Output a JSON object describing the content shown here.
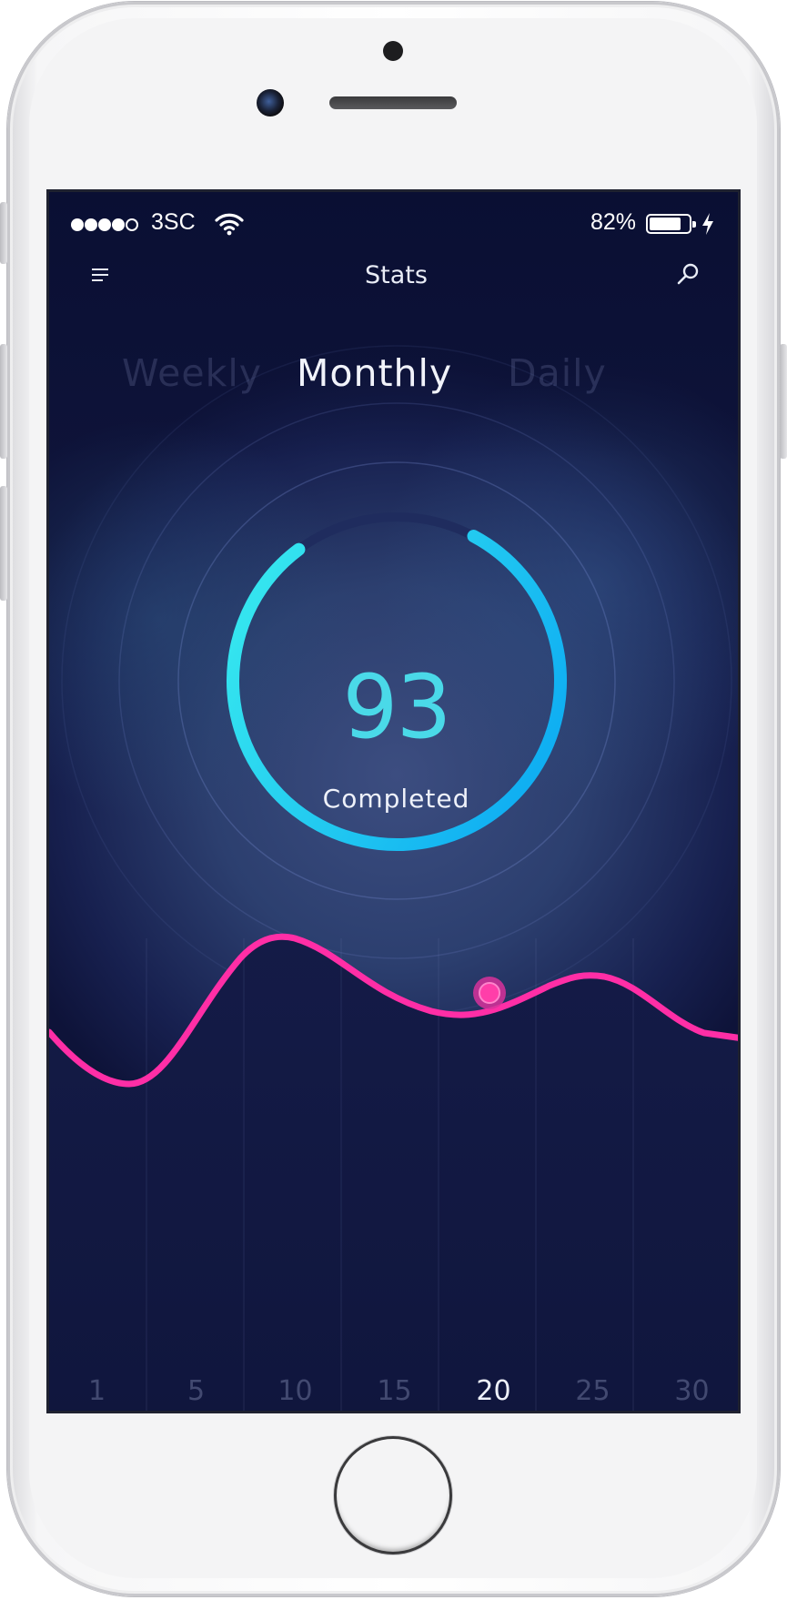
{
  "status_bar": {
    "signal_bars_filled": 4,
    "signal_bars_total": 5,
    "carrier": "3SC",
    "battery_percent": "82%",
    "battery_level": 0.82,
    "icons": [
      "signal-dots-icon",
      "wifi-icon",
      "battery-icon",
      "charging-bolt-icon"
    ]
  },
  "header": {
    "title": "Stats",
    "left_icon": "menu-icon",
    "right_icon": "search-icon"
  },
  "tabs": [
    {
      "label": "Weekly",
      "active": false
    },
    {
      "label": "Monthly",
      "active": true
    },
    {
      "label": "Daily",
      "active": false
    }
  ],
  "progress_ring": {
    "value": "93",
    "label": "Completed",
    "filled_fraction": 0.82,
    "colors": {
      "start": "#32e2ee",
      "end": "#12b0f2",
      "track": "#1f2c5e"
    }
  },
  "chart_data": {
    "type": "line",
    "x_ticks": [
      "1",
      "5",
      "10",
      "15",
      "20",
      "25",
      "30"
    ],
    "highlighted_tick": "20",
    "selected_point_x": 20,
    "line_color": "#ff2ea6",
    "background_colors": {
      "top": "#0b1035",
      "glow": "#3b4f80",
      "bottom": "#11163f"
    }
  }
}
